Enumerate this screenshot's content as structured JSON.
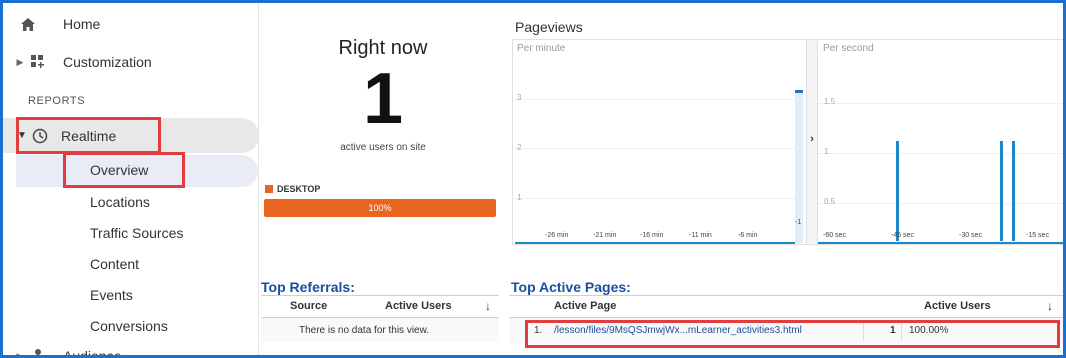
{
  "sidebar": {
    "home": "Home",
    "customization": "Customization",
    "reports_label": "REPORTS",
    "realtime": "Realtime",
    "realtime_items": [
      "Overview",
      "Locations",
      "Traffic Sources",
      "Content",
      "Events",
      "Conversions"
    ],
    "audience": "Audience"
  },
  "right_now": {
    "title": "Right now",
    "count": "1",
    "subtitle": "active users on site",
    "device_label": "DESKTOP",
    "device_percent": "100%",
    "device_share": 1.0,
    "device_color": "#e8651f"
  },
  "pageviews": {
    "title": "Pageviews",
    "per_minute": {
      "label": "Per minute",
      "y_ticks": [
        "3",
        "2",
        "1"
      ],
      "x_ticks": [
        "-26 min",
        "-21 min",
        "-16 min",
        "-11 min",
        "-6 min"
      ],
      "edge_label": "-1"
    },
    "per_second": {
      "label": "Per second",
      "y_ticks": [
        "1.5",
        "1",
        "0.5"
      ],
      "x_ticks": [
        "-60 sec",
        "-45 sec",
        "-30 sec",
        "-15 sec"
      ]
    },
    "bar_color": "#1a88c9"
  },
  "top_referrals": {
    "title": "Top Referrals:",
    "columns": [
      "Source",
      "Active Users"
    ],
    "empty_message": "There is no data for this view."
  },
  "top_active_pages": {
    "title": "Top Active Pages:",
    "columns": [
      "Active Page",
      "Active Users"
    ],
    "rows": [
      {
        "index": "1.",
        "page": "/lesson/files/9MsQSJmwjWx...mLearner_activities3.html",
        "users": "1",
        "percent": "100.00%"
      }
    ]
  },
  "accent_color": "#e23b40"
}
